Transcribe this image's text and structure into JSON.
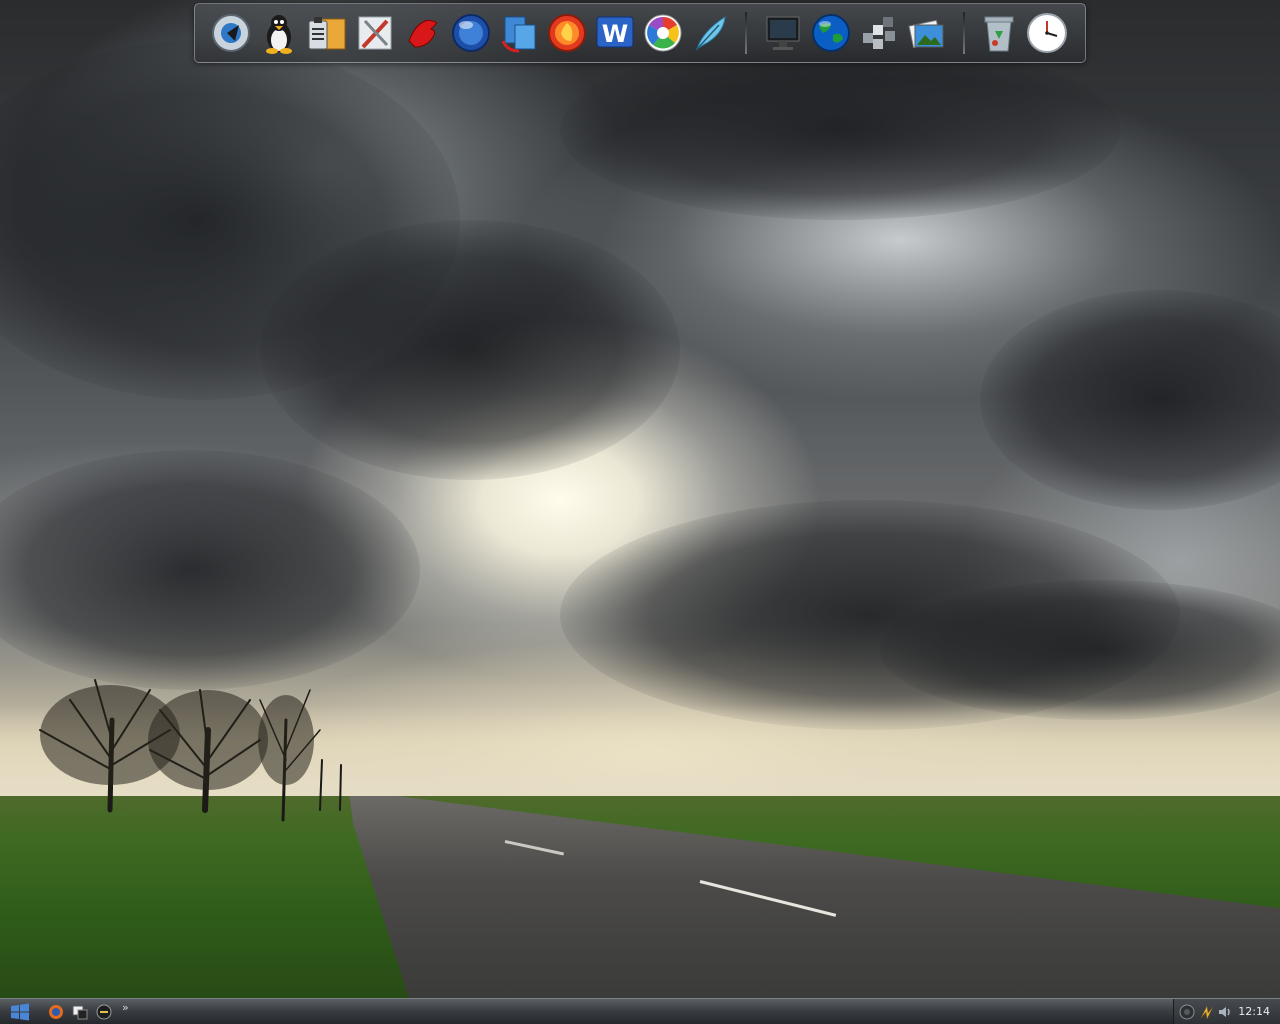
{
  "desktop": {
    "wallpaper": "stormy-sky-road-field-wallpaper"
  },
  "dock": {
    "items": [
      {
        "name": "quicktime-icon"
      },
      {
        "name": "tux-linux-icon"
      },
      {
        "name": "clipboard-folder-icon"
      },
      {
        "name": "tools-icon"
      },
      {
        "name": "red-hand-icon"
      },
      {
        "name": "blue-orb-icon"
      },
      {
        "name": "sync-icon"
      },
      {
        "name": "firefox-icon"
      },
      {
        "name": "word-icon",
        "label": "W"
      },
      {
        "name": "picasa-icon"
      },
      {
        "name": "feather-icon"
      },
      {
        "name": "monitor-icon"
      },
      {
        "name": "globe-icon"
      },
      {
        "name": "blocks-icon"
      },
      {
        "name": "photos-icon"
      },
      {
        "name": "recycle-bin-icon"
      },
      {
        "name": "clock-icon"
      }
    ]
  },
  "taskbar": {
    "start_icon": "windows-logo-icon",
    "quicklaunch": [
      {
        "name": "firefox-quicklaunch-icon"
      },
      {
        "name": "desktop-quicklaunch-icon"
      },
      {
        "name": "media-quicklaunch-icon"
      }
    ],
    "chevron": "»",
    "tray": {
      "icons": [
        "power-tray-icon",
        "network-tray-icon",
        "volume-tray-icon"
      ],
      "time": "12:14"
    }
  },
  "colors": {
    "taskbar_top": "#5a5f64",
    "taskbar_bottom": "#23262a",
    "clock_text": "#e8ecef"
  }
}
